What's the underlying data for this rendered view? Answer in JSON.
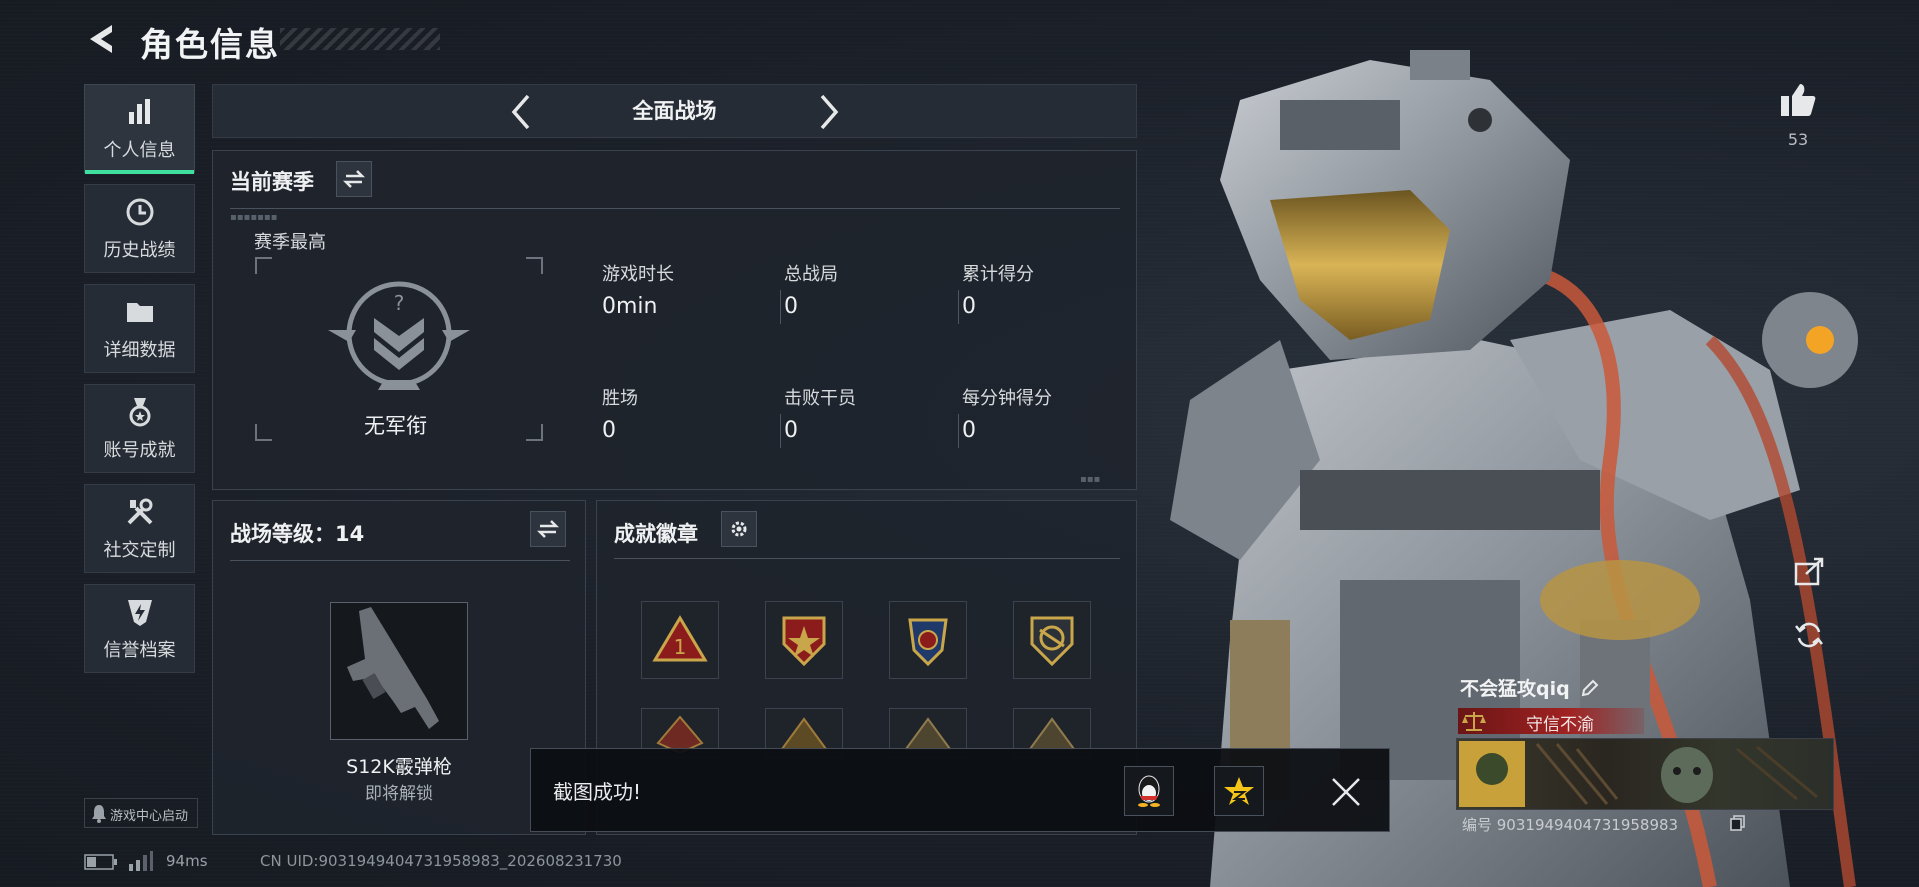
{
  "header": {
    "title": "角色信息"
  },
  "sidebar": {
    "items": [
      {
        "label": "个人信息"
      },
      {
        "label": "历史战绩"
      },
      {
        "label": "详细数据"
      },
      {
        "label": "账号成就"
      },
      {
        "label": "社交定制"
      },
      {
        "label": "信誉档案"
      }
    ]
  },
  "mode": {
    "label": "全面战场"
  },
  "season": {
    "title": "当前赛季",
    "best_label": "赛季最高",
    "rank_name": "无军衔",
    "stats": [
      {
        "label": "游戏时长",
        "value": "0min"
      },
      {
        "label": "总战局",
        "value": "0"
      },
      {
        "label": "累计得分",
        "value": "0"
      },
      {
        "label": "胜场",
        "value": "0"
      },
      {
        "label": "击败干员",
        "value": "0"
      },
      {
        "label": "每分钟得分",
        "value": "0"
      }
    ]
  },
  "battle_level": {
    "title": "战场等级：14",
    "weapon_name": "S12K霰弹枪",
    "weapon_status": "即将解锁"
  },
  "achievements": {
    "title": "成就徽章"
  },
  "likes": {
    "count": "53"
  },
  "player": {
    "name": "不会猛攻qiq",
    "reputation": "守信不渝",
    "id_text": "编号 9031949404731958983"
  },
  "toast": {
    "text": "截图成功!"
  },
  "footer": {
    "launch": "游戏中心启动",
    "ping": "94ms",
    "uid": "CN UID:9031949404731958983_202608231730"
  },
  "colors": {
    "accent": "#3fe0a0",
    "gold": "#c9a64a",
    "reputation_red": "#8c1c1c"
  }
}
